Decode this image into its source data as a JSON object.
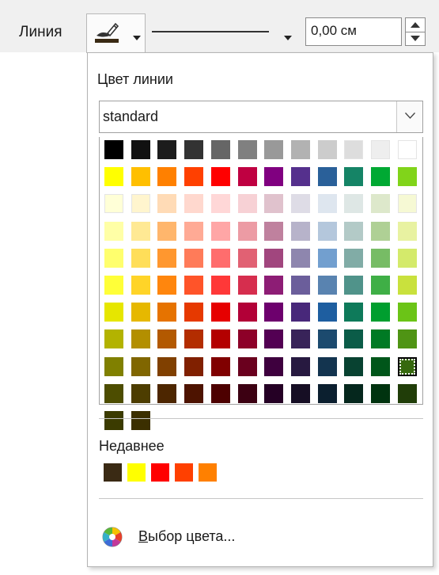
{
  "toolbar": {
    "line_label": "Линия",
    "line_width_value": "0,00 см"
  },
  "popup": {
    "title": "Цвет линии",
    "palette_name": "standard",
    "recent_title": "Недавнее",
    "pick_color_first_letter": "В",
    "pick_color_rest": "ыбор цвета..."
  },
  "palette": {
    "columns": 12,
    "selected_index": 107,
    "colors": [
      "#000000",
      "#111111",
      "#1c1c1c",
      "#333333",
      "#666666",
      "#808080",
      "#999999",
      "#b2b2b2",
      "#cccccc",
      "#dddddd",
      "#eeeeee",
      "#ffffff",
      "#ffff00",
      "#ffbf00",
      "#ff8000",
      "#ff4000",
      "#ff0000",
      "#bf0041",
      "#800080",
      "#55308d",
      "#2a6099",
      "#158466",
      "#00a933",
      "#81d41a",
      "#ffffd7",
      "#fff5ce",
      "#ffdbb6",
      "#ffd8ce",
      "#ffd7d7",
      "#f7d1d5",
      "#e0c2cd",
      "#dedce6",
      "#dee6ef",
      "#dee7e5",
      "#dde8cb",
      "#f6f9d4",
      "#ffffa6",
      "#ffe994",
      "#ffb66c",
      "#ffaa95",
      "#ffa6a6",
      "#ec9ba4",
      "#bf819e",
      "#b7b3ca",
      "#b4c7dc",
      "#b3cac7",
      "#afd095",
      "#e8f2a1",
      "#ffff6d",
      "#ffde59",
      "#ff972f",
      "#ff7b59",
      "#ff6d6d",
      "#e16173",
      "#a1467e",
      "#8e86ae",
      "#729fcf",
      "#81aca6",
      "#77bc65",
      "#d4ea6b",
      "#ffff38",
      "#ffd428",
      "#ff860d",
      "#ff5429",
      "#ff3838",
      "#d62e4e",
      "#8d1d75",
      "#6b5e9b",
      "#5983b0",
      "#50938a",
      "#3faf46",
      "#c9e13d",
      "#e6e600",
      "#e6b800",
      "#e67300",
      "#e63900",
      "#e60000",
      "#b20037",
      "#6d006d",
      "#48287a",
      "#1e5ea0",
      "#0e7a5a",
      "#009e2f",
      "#6bc417",
      "#b3b300",
      "#b38f00",
      "#b35900",
      "#b32d00",
      "#b30000",
      "#8d0028",
      "#530053",
      "#382359",
      "#1c4a6e",
      "#0b5c48",
      "#007a24",
      "#4f9414",
      "#808000",
      "#806600",
      "#804000",
      "#802000",
      "#800000",
      "#6a001e",
      "#3e003e",
      "#271940",
      "#13344f",
      "#084231",
      "#00561a",
      "#36690e",
      "#4d4d00",
      "#4d3d00",
      "#4d2600",
      "#4d1300",
      "#4d0000",
      "#3c0012",
      "#250025",
      "#160e24",
      "#0b1f2f",
      "#05271d",
      "#00330f",
      "#203d08",
      "#3b3b00",
      "#3b2f00"
    ]
  },
  "recent_colors": [
    "#3a2a14",
    "#ffff00",
    "#ff0000",
    "#ff4000",
    "#ff8000"
  ]
}
